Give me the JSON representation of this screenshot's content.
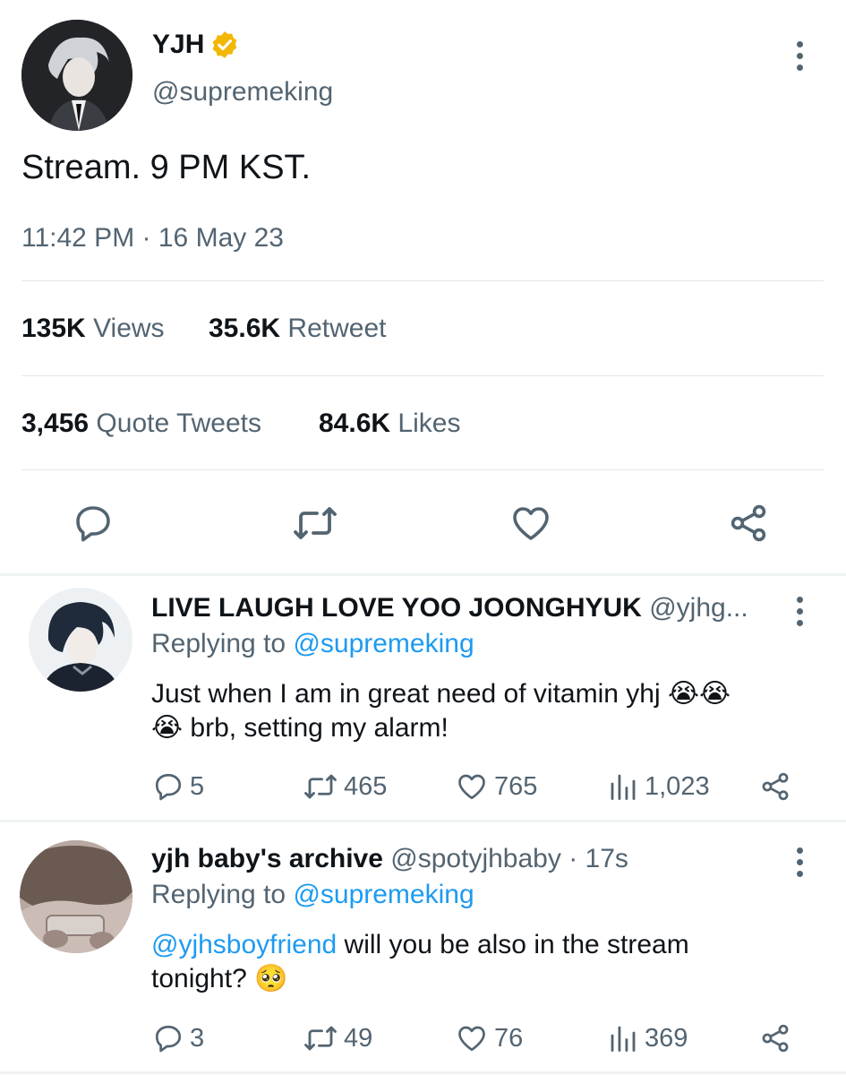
{
  "tweet": {
    "author": {
      "name": "YJH",
      "handle": "@supremeking",
      "verified_icon": "verified-badge-icon"
    },
    "text": "Stream. 9 PM KST.",
    "time": "11:42 PM",
    "separator": "·",
    "date": "16 May 23",
    "stats": {
      "views_count": "135K",
      "views_label": "Views",
      "retweets_count": "35.6K",
      "retweets_label": "Retweet",
      "quotes_count": "3,456",
      "quotes_label": "Quote Tweets",
      "likes_count": "84.6K",
      "likes_label": "Likes"
    }
  },
  "replies": [
    {
      "name": "LIVE LAUGH LOVE YOO JOONGHYUK",
      "handle": "@yjhg...",
      "time": "",
      "replying_label": "Replying to",
      "replying_to": "@supremeking",
      "text_line1": "Just when I am in great need of vitamin yhj 😭😭",
      "text_line2": "😭 brb, setting my alarm!",
      "counts": {
        "replies": "5",
        "retweets": "465",
        "likes": "765",
        "views": "1,023"
      }
    },
    {
      "name": "yjh baby's archive",
      "handle": "@spotyjhbaby",
      "separator": "·",
      "time": "17s",
      "replying_label": "Replying to",
      "replying_to": "@supremeking",
      "mention": "@yjhsboyfriend",
      "text_line1_rest": " will you be also in the stream",
      "text_line2": "tonight? 🥺",
      "counts": {
        "replies": "3",
        "retweets": "49",
        "likes": "76",
        "views": "369"
      }
    }
  ],
  "colors": {
    "accent": "#1d9bf0",
    "verified": "#f2b705",
    "muted": "#536471",
    "text": "#0f1419"
  }
}
